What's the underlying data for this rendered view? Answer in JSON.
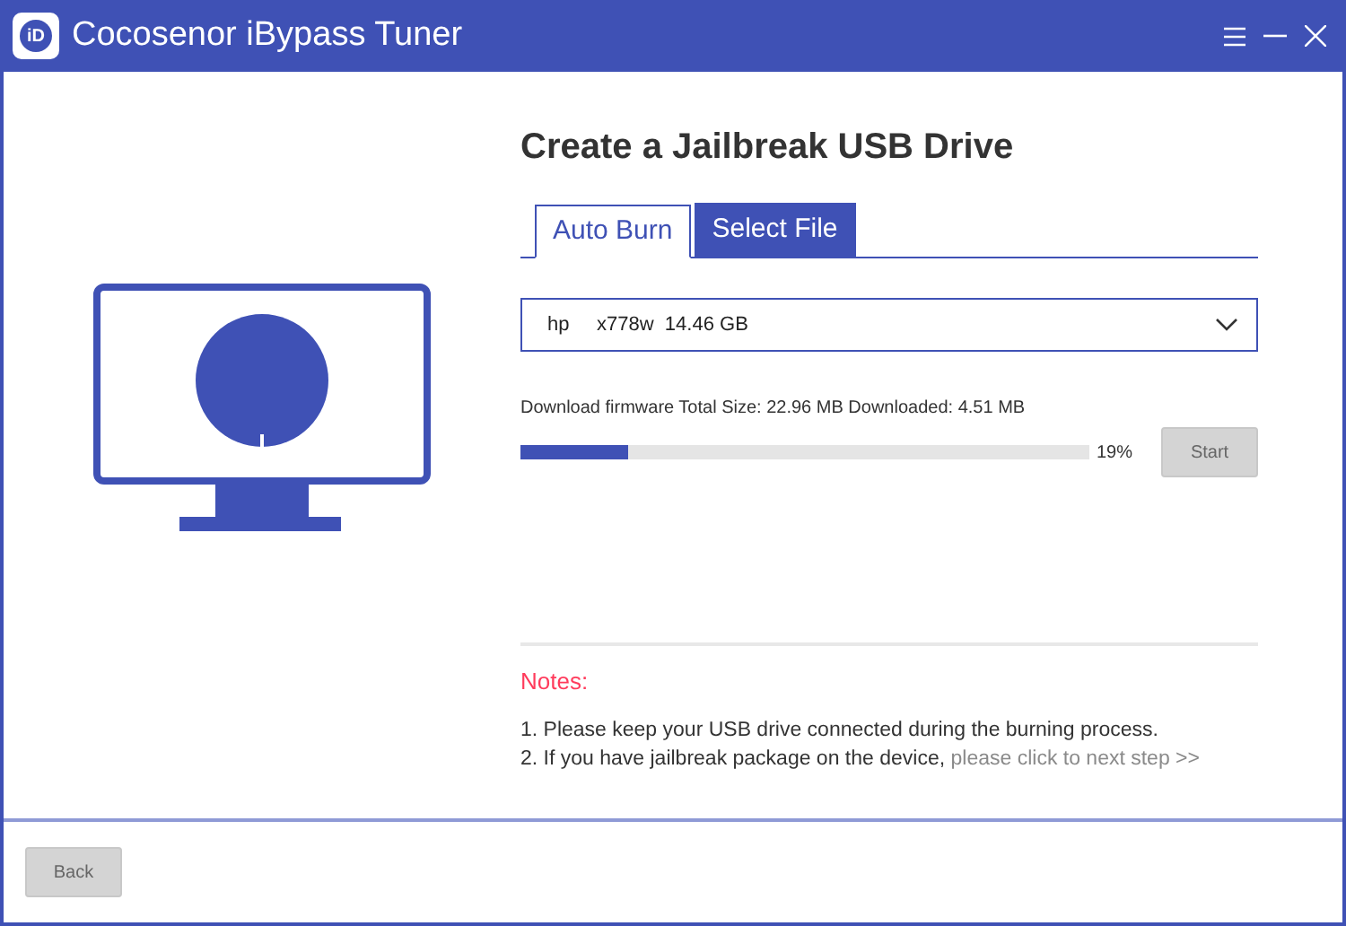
{
  "window": {
    "title": "Cocosenor iBypass Tuner",
    "logo": "iD"
  },
  "heading": "Create a Jailbreak USB Drive",
  "tabs": [
    {
      "label": "Auto Burn",
      "selected": true
    },
    {
      "label": "Select File",
      "selected": false
    }
  ],
  "drive_select": {
    "value": "hp     x778w  14.46 GB"
  },
  "download": {
    "status": "Download firmware Total Size: 22.96 MB Downloaded: 4.51 MB",
    "level": 0.19,
    "percent": "19%"
  },
  "start_button": {
    "label": "Start",
    "disabled": true
  },
  "notes": {
    "title": "Notes:",
    "lines": [
      "1. Please keep your USB drive connected during the burning process.",
      "2. If you have jailbreak package on the device,"
    ],
    "link": "please click to next step >>"
  },
  "back_button": {
    "label": "Back",
    "disabled": true
  }
}
